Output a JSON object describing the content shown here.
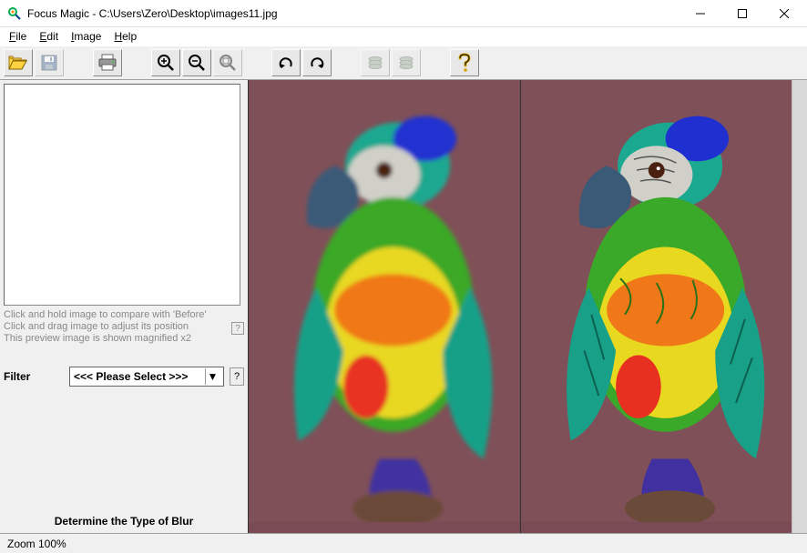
{
  "window": {
    "title": "Focus Magic - C:\\Users\\Zero\\Desktop\\images11.jpg"
  },
  "menu": {
    "file": "File",
    "edit": "Edit",
    "image": "Image",
    "help": "Help"
  },
  "toolbar": {
    "open": "open-icon",
    "save": "save-icon",
    "print": "print-icon",
    "zoom_in": "zoom-in-icon",
    "zoom_out": "zoom-out-icon",
    "zoom_fit": "zoom-fit-icon",
    "undo": "undo-icon",
    "redo": "redo-icon",
    "stack1": "stack-icon",
    "stack2": "stack-icon",
    "help": "help-icon"
  },
  "sidebar": {
    "hint1": "Click and hold image to compare with 'Before'",
    "hint2": "Click and drag image to adjust its position",
    "hint3": "This preview image is shown magnified x2",
    "filter_label": "Filter",
    "filter_value": "<<< Please Select >>>",
    "determine": "Determine the Type of Blur"
  },
  "status": {
    "zoom": "Zoom 100%"
  }
}
